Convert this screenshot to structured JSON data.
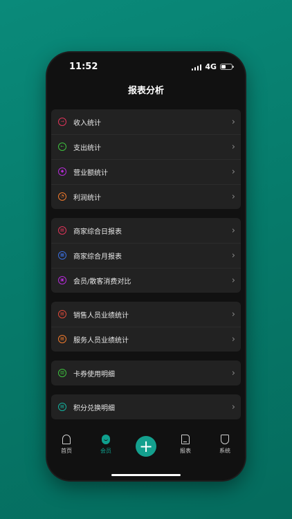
{
  "status": {
    "time": "11:52",
    "network": "4G"
  },
  "page": {
    "title": "报表分析"
  },
  "groups": [
    {
      "items": [
        {
          "label": "收入统计",
          "icon": "income-icon",
          "color": "#e0345a"
        },
        {
          "label": "支出统计",
          "icon": "expense-icon",
          "color": "#3ec23e"
        },
        {
          "label": "营业额统计",
          "icon": "revenue-icon",
          "color": "#b42bd6"
        },
        {
          "label": "利润统计",
          "icon": "profit-icon",
          "color": "#f07a2c"
        }
      ]
    },
    {
      "items": [
        {
          "label": "商家综合日报表",
          "icon": "daily-report-icon",
          "color": "#e0345a"
        },
        {
          "label": "商家综合月报表",
          "icon": "monthly-report-icon",
          "color": "#3a6fe0"
        },
        {
          "label": "会员/散客消费对比",
          "icon": "member-compare-icon",
          "color": "#b42bd6"
        }
      ]
    },
    {
      "items": [
        {
          "label": "销售人员业绩统计",
          "icon": "sales-staff-icon",
          "color": "#e04a3a"
        },
        {
          "label": "服务人员业绩统计",
          "icon": "service-staff-icon",
          "color": "#f07a2c"
        }
      ]
    },
    {
      "items": [
        {
          "label": "卡券使用明细",
          "icon": "coupon-icon",
          "color": "#3ec23e"
        }
      ]
    },
    {
      "items": [
        {
          "label": "积分兑换明细",
          "icon": "points-icon",
          "color": "#14b3a0"
        }
      ]
    }
  ],
  "tabs": {
    "home": "首页",
    "member": "会员",
    "report": "报表",
    "system": "系统"
  },
  "colors": {
    "accent": "#0fa08e",
    "background": "#111111",
    "card": "#222222"
  }
}
